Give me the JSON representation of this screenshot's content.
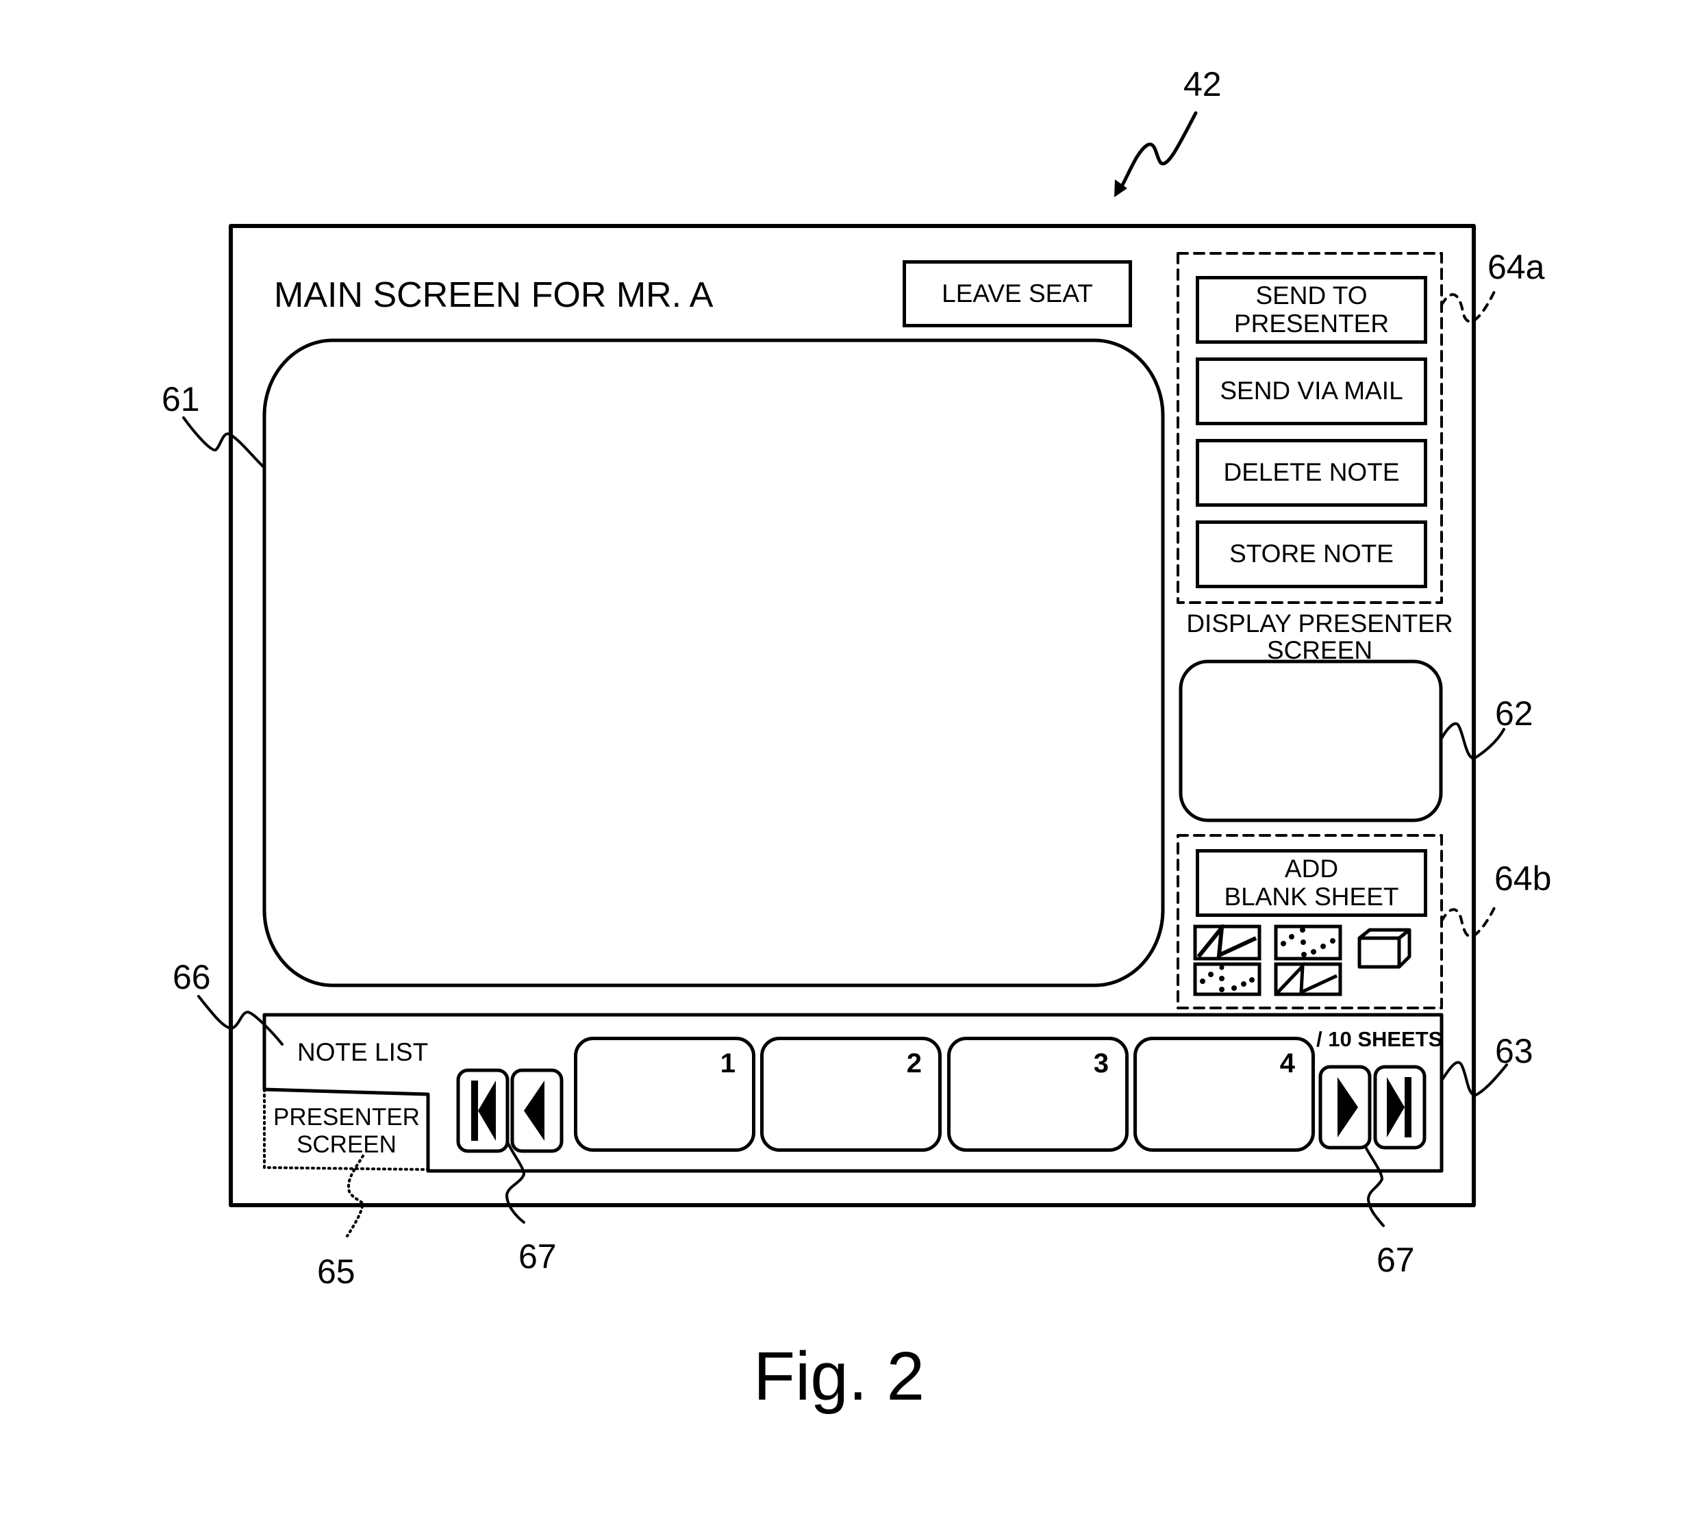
{
  "figure": {
    "caption": "Fig. 2",
    "reference_numerals": {
      "screen": "42",
      "main_area": "61",
      "presenter_preview": "62",
      "note_list_panel": "63",
      "button_group_a": "64a",
      "button_group_b": "64b",
      "presenter_screen_tab": "65",
      "note_list_tab": "66",
      "nav_buttons_left": "67",
      "nav_buttons_right": "67"
    }
  },
  "header": {
    "title": "MAIN SCREEN FOR MR. A",
    "leave_seat_label": "LEAVE SEAT"
  },
  "actions": {
    "send_to_presenter_line1": "SEND TO",
    "send_to_presenter_line2": "PRESENTER",
    "send_via_mail": "SEND VIA MAIL",
    "delete_note": "DELETE NOTE",
    "store_note": "STORE NOTE"
  },
  "presenter_preview": {
    "label_line1": "DISPLAY PRESENTER",
    "label_line2": "SCREEN"
  },
  "tools": {
    "add_blank_sheet_line1": "ADD",
    "add_blank_sheet_line2": "BLANK SHEET",
    "icons": [
      "solid-pen-thick-icon",
      "dotted-pen-thick-icon",
      "eraser-icon",
      "dotted-pen-thin-icon",
      "solid-pen-thin-icon"
    ]
  },
  "note_list": {
    "tabs": [
      {
        "label": "NOTE LIST",
        "active": true
      },
      {
        "label_line1": "PRESENTER",
        "label_line2": "SCREEN",
        "active": false
      }
    ],
    "sheets": [
      "1",
      "2",
      "3",
      "4"
    ],
    "total_label": "/ 10 SHEETS",
    "nav": [
      "first-page-icon",
      "previous-page-icon",
      "next-page-icon",
      "last-page-icon"
    ]
  }
}
